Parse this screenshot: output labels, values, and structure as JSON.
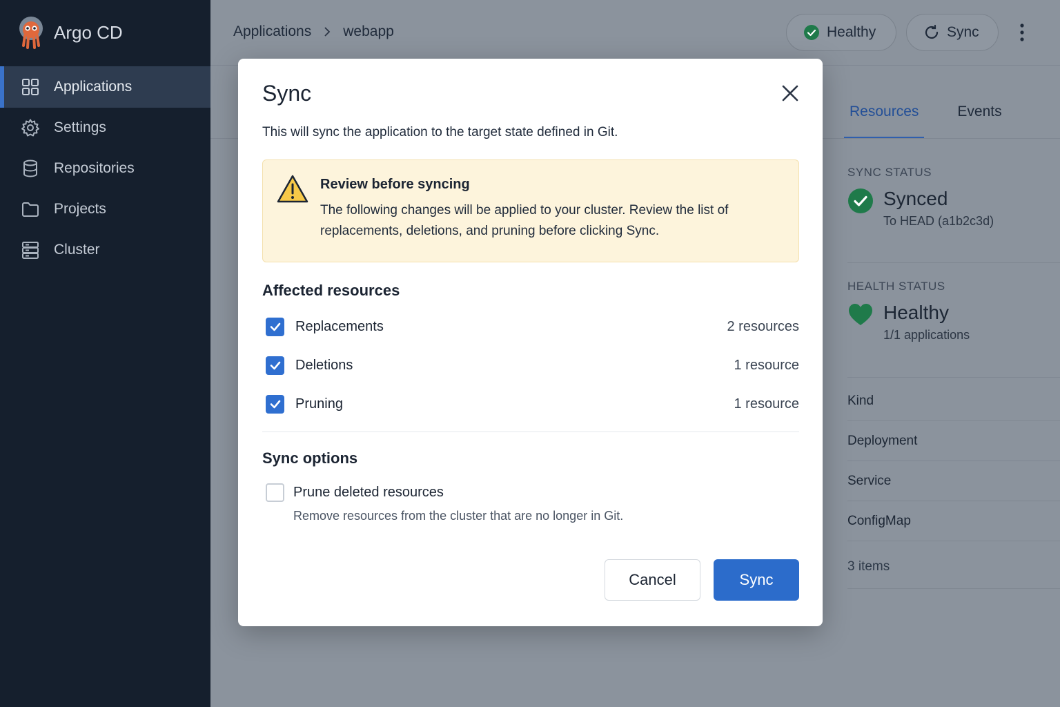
{
  "app": {
    "name": "Argo CD"
  },
  "sidebar": {
    "items": [
      {
        "label": "Applications",
        "icon": "grid-icon",
        "active": true
      },
      {
        "label": "Settings",
        "icon": "gear-icon",
        "active": false
      },
      {
        "label": "Repositories",
        "icon": "database-icon",
        "active": false
      },
      {
        "label": "Projects",
        "icon": "folder-icon",
        "active": false
      },
      {
        "label": "Cluster",
        "icon": "server-icon",
        "active": false
      }
    ]
  },
  "header": {
    "breadcrumb": [
      "Applications",
      "webapp"
    ],
    "health_label": "Healthy",
    "sync_label": "Sync"
  },
  "tabs": [
    {
      "label": "Resources",
      "active": true
    },
    {
      "label": "Events",
      "active": false
    }
  ],
  "status": {
    "sync_heading": "SYNC STATUS",
    "sync_value": "Synced",
    "sync_sub": "To HEAD (a1b2c3d)",
    "health_heading": "HEALTH STATUS",
    "health_value": "Healthy",
    "health_sub": "1/1 applications"
  },
  "resource_table": {
    "header": "Kind",
    "rows": [
      "Deployment",
      "Service",
      "ConfigMap"
    ],
    "count": "3 items"
  },
  "modal": {
    "title": "Sync",
    "description": "This will sync the application to the target state defined in Git.",
    "warning": {
      "title": "Review before syncing",
      "text": "The following changes will be applied to your cluster. Review the list of replacements, deletions, and pruning before clicking Sync."
    },
    "affected_title": "Affected resources",
    "affected": [
      {
        "label": "Replacements",
        "count": "2 resources",
        "checked": true
      },
      {
        "label": "Deletions",
        "count": "1 resource",
        "checked": true
      },
      {
        "label": "Pruning",
        "count": "1 resource",
        "checked": true
      }
    ],
    "options_title": "Sync options",
    "option": {
      "label": "Prune deleted resources",
      "description": "Remove resources from the cluster that are no longer in Git.",
      "checked": false
    },
    "cancel_label": "Cancel",
    "sync_label": "Sync"
  },
  "colors": {
    "accent": "#2c6ccb",
    "success": "#2e9b5d",
    "warning_bg": "#fdf4dc",
    "sidebar_bg": "#151f2d"
  }
}
